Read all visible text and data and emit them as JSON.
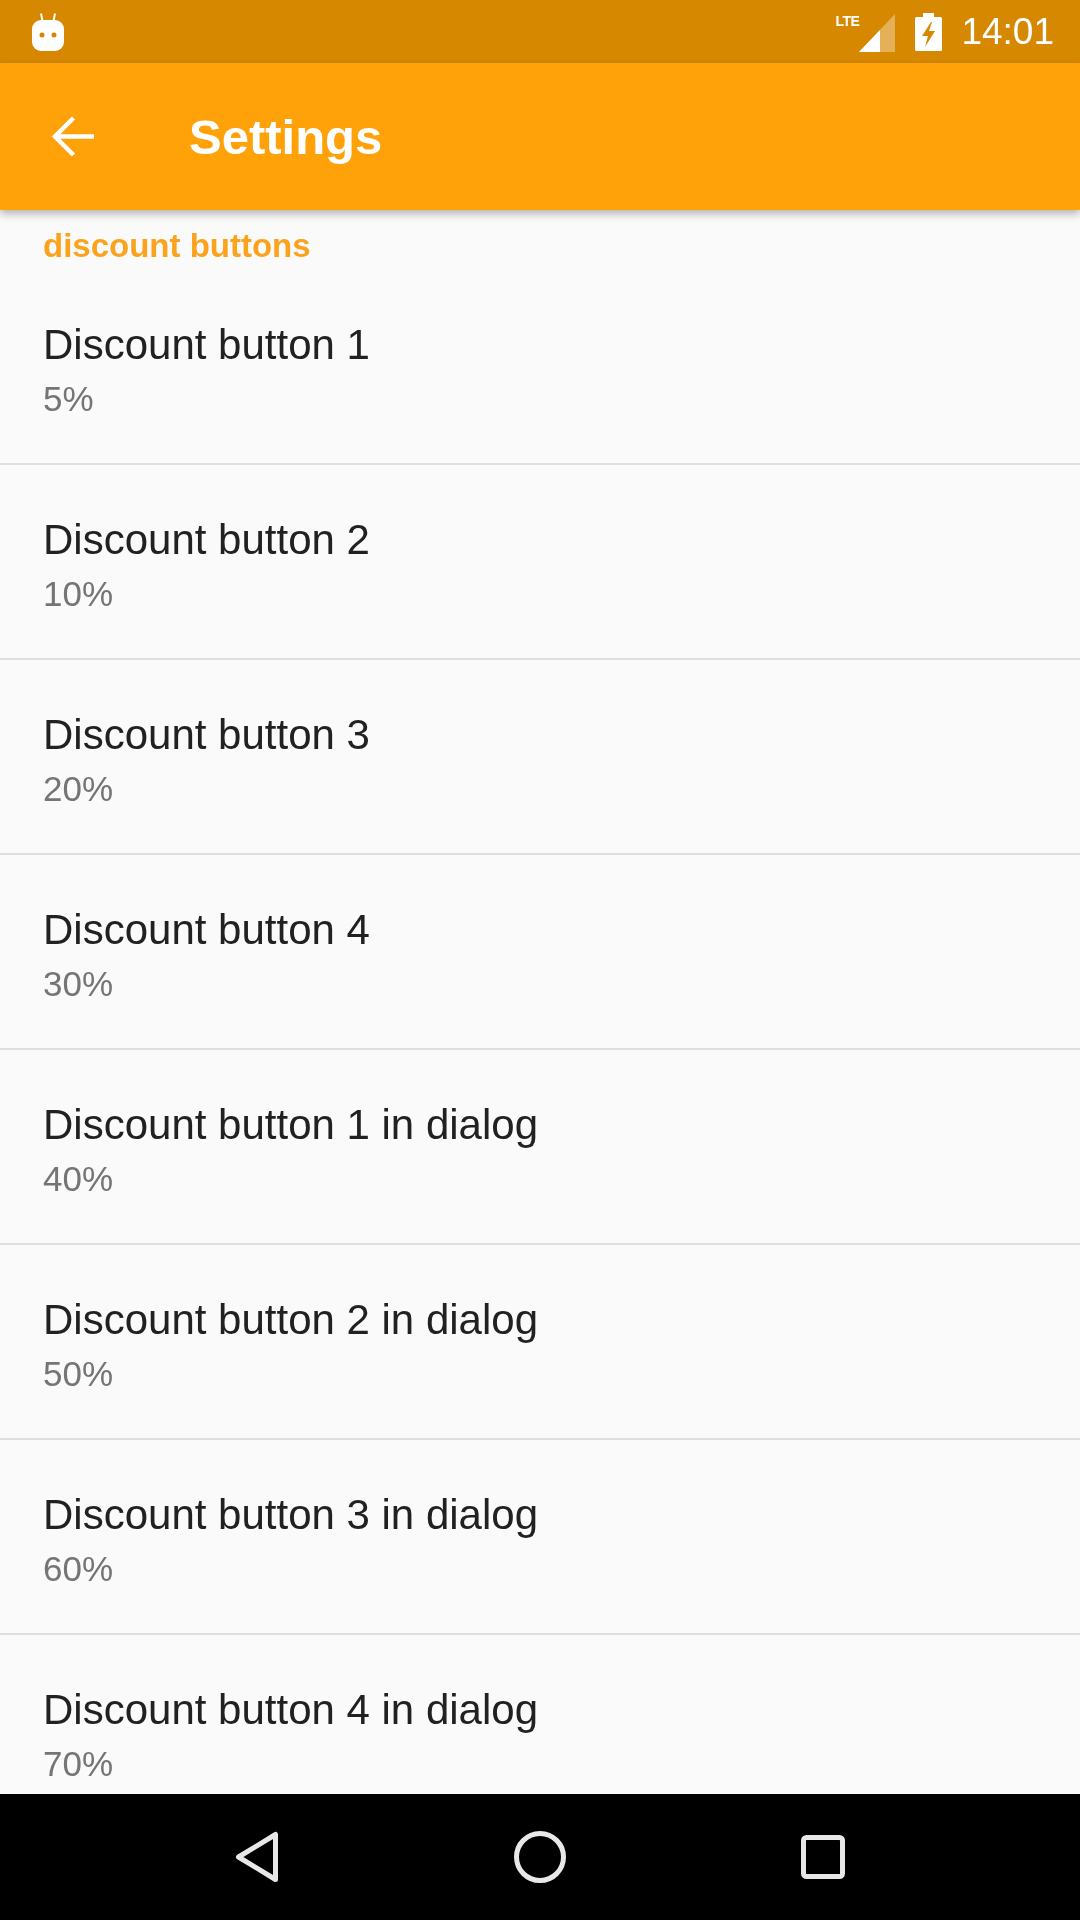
{
  "status_bar": {
    "network_type": "LTE",
    "time": "14:01"
  },
  "app_bar": {
    "title": "Settings"
  },
  "category": {
    "title": "discount buttons"
  },
  "preferences": [
    {
      "title": "Discount button 1",
      "summary": "5%"
    },
    {
      "title": "Discount button 2",
      "summary": "10%"
    },
    {
      "title": "Discount button 3",
      "summary": "20%"
    },
    {
      "title": "Discount button 4",
      "summary": "30%"
    },
    {
      "title": "Discount button 1 in dialog",
      "summary": "40%"
    },
    {
      "title": "Discount button 2 in dialog",
      "summary": "50%"
    },
    {
      "title": "Discount button 3 in dialog",
      "summary": "60%"
    },
    {
      "title": "Discount button 4 in dialog",
      "summary": "70%"
    }
  ]
}
